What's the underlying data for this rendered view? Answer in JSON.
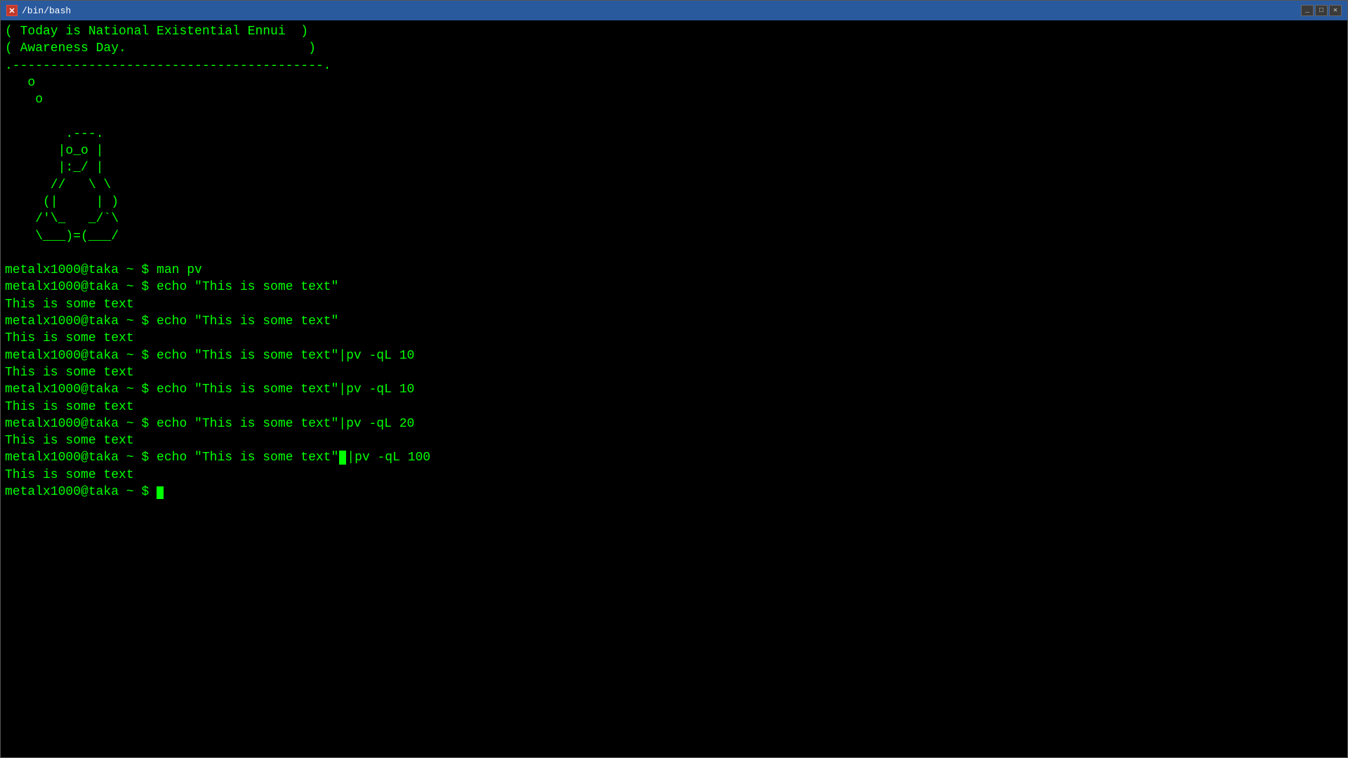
{
  "window": {
    "title": "/bin/bash"
  },
  "terminal": {
    "lines": [
      "( Today is National Existential Ennui  )",
      "( Awareness Day.                        )",
      ".-----------------------------------------.",
      "   o",
      "    o",
      "",
      "        .---.",
      "       |o_o |",
      "       |:_/ |",
      "      //   \\ \\",
      "     (|     | )",
      "    /'\\_   _/`\\",
      "    \\___)=(___/",
      "",
      "metalx1000@taka ~ $ man pv",
      "metalx1000@taka ~ $ echo \"This is some text\"",
      "This is some text",
      "metalx1000@taka ~ $ echo \"This is some text\"",
      "This is some text",
      "metalx1000@taka ~ $ echo \"This is some text\"|pv -qL 10",
      "This is some text",
      "metalx1000@taka ~ $ echo \"This is some text\"|pv -qL 10",
      "This is some text",
      "metalx1000@taka ~ $ echo \"This is some text\"|pv -qL 20",
      "This is some text",
      "metalx1000@taka ~ $ echo \"This is some text\"|pv -qL 100",
      "This is some text",
      "metalx1000@taka ~ $ "
    ]
  }
}
